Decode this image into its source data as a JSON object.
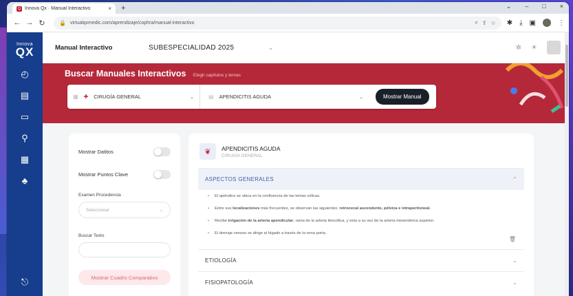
{
  "browser": {
    "tab_title": "Innova Qx · Manual Interactivo",
    "tab_close": "×",
    "new_tab": "+",
    "window_controls": [
      "⌄",
      "–",
      "□",
      "×"
    ],
    "url": "virtualqxmedic.com/aprendizaje/cophra/manual-interactivo"
  },
  "logo": {
    "top": "Innova",
    "main": "QX"
  },
  "header": {
    "title": "Manual Interactivo",
    "subtitle": "SUBESPECIALIDAD 2025"
  },
  "banner": {
    "title": "Buscar Manuales Interactivos",
    "hint": "Elegir capítulos y temas",
    "specialty_value": "CIRUGÍA GENERAL",
    "topic_value": "APENDICITIS AGUDA",
    "show_button": "Mostrar Manual"
  },
  "filters": {
    "show_data_label": "Mostrar Datitos",
    "show_key_points_label": "Mostrar Puntos Clave",
    "exam_label": "Examen Procedencia",
    "exam_placeholder": "Seleccionar",
    "search_label": "Buscar Texto",
    "compare_button": "Mostrar Cuadro Comparativo"
  },
  "manual": {
    "title": "APENDICITIS AGUDA",
    "subtitle": "CIRUGÍA GENERAL",
    "sections": [
      {
        "title": "ASPECTOS GENERALES"
      },
      {
        "title": "ETIOLOGÍA"
      },
      {
        "title": "FISIOPATOLOGÍA"
      }
    ],
    "bullets": [
      {
        "pre": "El apéndice se ubica en la confluencia de las tenias cólicas.",
        "bold": "",
        "post": ""
      },
      {
        "pre": "Entre sus ",
        "bold": "localizaciones",
        "post": " más frecuentes, se observan las siguientes: ",
        "bold2": "retrocecal ascendente, pélvica e intraperitoneal."
      },
      {
        "pre": "Recibe ",
        "bold": "irrigación de la arteria apendicular",
        "post": ", rama de la arteria ileocólica, y esta a su vez de la arteria mesentérica superior."
      },
      {
        "pre": "El drenaje venoso se dirige al hígado a través de la vena porta.",
        "bold": "",
        "post": ""
      }
    ]
  },
  "colors": {
    "nav": "#163e8c",
    "banner": "#b5283a",
    "accent": "#3c5fa8"
  }
}
